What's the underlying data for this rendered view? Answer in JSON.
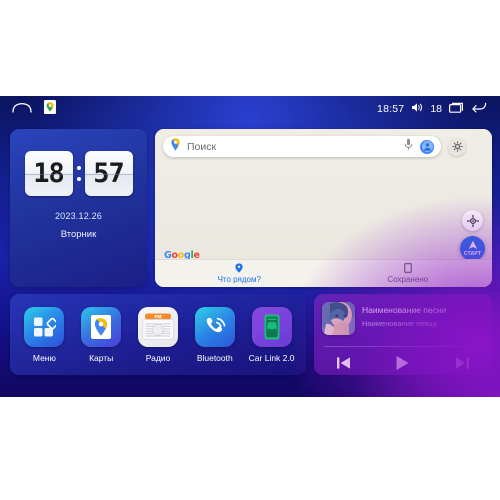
{
  "statusbar": {
    "home_icon": "home-icon",
    "maps_pin_icon": "maps-pin-icon",
    "time": "18:57",
    "volume_icon": "volume-icon",
    "volume_level": "18",
    "recents_icon": "recents-icon",
    "back_icon": "back-icon"
  },
  "clock_widget": {
    "hours": "18",
    "minutes": "57",
    "date": "2023.12.26",
    "weekday": "Вторник"
  },
  "map_widget": {
    "search_placeholder": "Поиск",
    "pin_icon": "maps-pin-icon",
    "mic_icon": "microphone-icon",
    "account_icon": "account-avatar-icon",
    "settings_icon": "gear-icon",
    "brand": "Google",
    "brand_letters": [
      "G",
      "o",
      "o",
      "g",
      "l",
      "e"
    ],
    "locate_icon": "locate-me-icon",
    "start_label": "СТАРТ",
    "tabs": [
      {
        "label": "Что рядом?",
        "icon": "map-pin-icon"
      },
      {
        "label": "Сохранено",
        "icon": "bookmark-icon"
      }
    ]
  },
  "apps": [
    {
      "label": "Меню",
      "icon": "menu-grid-icon"
    },
    {
      "label": "Карты",
      "icon": "maps-icon"
    },
    {
      "label": "Радио",
      "icon": "radio-icon",
      "band": "FM"
    },
    {
      "label": "Bluetooth",
      "icon": "bluetooth-phone-icon"
    },
    {
      "label": "Car Link 2.0",
      "icon": "car-link-icon"
    }
  ],
  "music_player": {
    "album_art": "album-art-portrait",
    "title": "Наименование песни",
    "artist": "Наименование певца",
    "controls": [
      {
        "name": "previous-track-button",
        "icon": "skip-previous-icon"
      },
      {
        "name": "play-button",
        "icon": "play-icon"
      },
      {
        "name": "next-track-button",
        "icon": "skip-next-icon"
      }
    ]
  },
  "colors": {
    "background_blue": "#1a21a8",
    "background_purple": "#7a18be",
    "accent_blue": "#1a73e8",
    "map_bg": "#eceae3",
    "music_panel": "#6a19af"
  }
}
